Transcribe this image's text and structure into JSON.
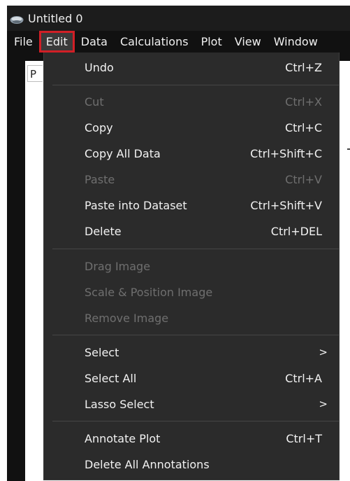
{
  "window": {
    "title": "Untitled 0",
    "app_icon": "app-logo-icon"
  },
  "menubar": {
    "items": [
      {
        "label": "File"
      },
      {
        "label": "Edit",
        "active": true
      },
      {
        "label": "Data"
      },
      {
        "label": "Calculations"
      },
      {
        "label": "Plot"
      },
      {
        "label": "View"
      },
      {
        "label": "Window"
      }
    ]
  },
  "workspace": {
    "tab_label": "P"
  },
  "edit_menu": {
    "items": [
      {
        "label": "Undo",
        "shortcut": "Ctrl+Z",
        "enabled": true
      },
      {
        "label": "Cut",
        "shortcut": "Ctrl+X",
        "enabled": false
      },
      {
        "label": "Copy",
        "shortcut": "Ctrl+C",
        "enabled": true
      },
      {
        "label": "Copy All Data",
        "shortcut": "Ctrl+Shift+C",
        "enabled": true
      },
      {
        "label": "Paste",
        "shortcut": "Ctrl+V",
        "enabled": false
      },
      {
        "label": "Paste into Dataset",
        "shortcut": "Ctrl+Shift+V",
        "enabled": true
      },
      {
        "label": "Delete",
        "shortcut": "Ctrl+DEL",
        "enabled": true
      },
      {
        "label": "Drag Image",
        "shortcut": "",
        "enabled": false
      },
      {
        "label": "Scale & Position Image",
        "shortcut": "",
        "enabled": false
      },
      {
        "label": "Remove Image",
        "shortcut": "",
        "enabled": false
      },
      {
        "label": "Select",
        "shortcut": "",
        "enabled": true,
        "submenu": true
      },
      {
        "label": "Select All",
        "shortcut": "Ctrl+A",
        "enabled": true
      },
      {
        "label": "Lasso Select",
        "shortcut": "",
        "enabled": true,
        "submenu": true
      },
      {
        "label": "Annotate Plot",
        "shortcut": "Ctrl+T",
        "enabled": true
      },
      {
        "label": "Delete All Annotations",
        "shortcut": "",
        "enabled": true
      }
    ],
    "submenu_arrow": ">"
  },
  "colors": {
    "titlebar_bg": "#1c1c1c",
    "menubar_bg": "#111111",
    "menu_bg": "#2b2b2b",
    "highlight_border": "#d11f26",
    "enabled_text": "#f2f2f2",
    "disabled_text": "#6f6f6f"
  }
}
